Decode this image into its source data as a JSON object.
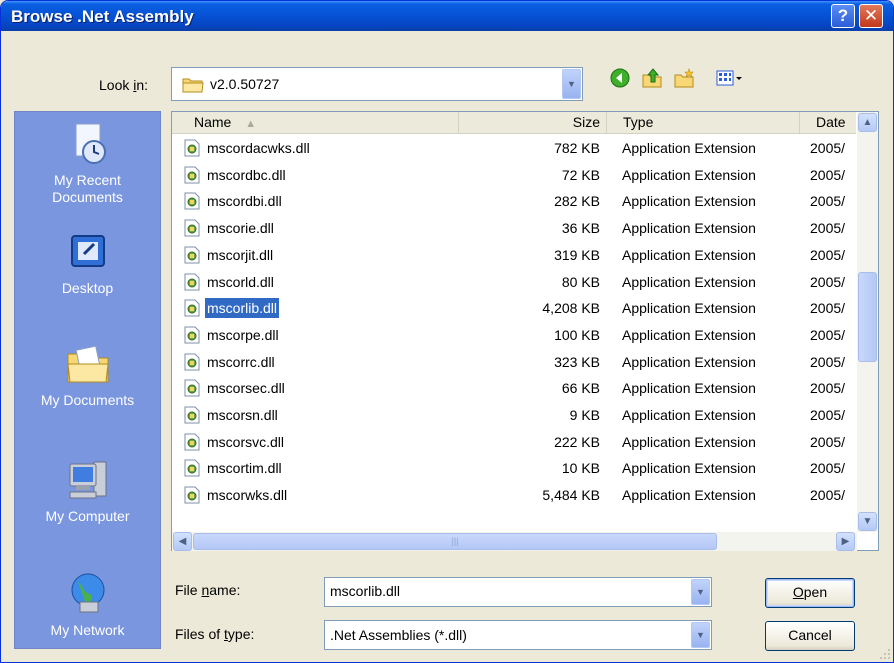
{
  "window": {
    "title": "Browse .Net Assembly"
  },
  "titlebar_buttons": {
    "help": "?",
    "close": "✕"
  },
  "look_in": {
    "label_pre": "Look ",
    "label_underlined": "i",
    "label_post": "n:",
    "value": "v2.0.50727"
  },
  "toolbar_icons": [
    "back-icon",
    "up-folder-icon",
    "new-folder-icon",
    "view-menu-icon"
  ],
  "places": [
    {
      "label_1": "My Recent",
      "label_2": "Documents",
      "icon": "recent-documents-icon"
    },
    {
      "label_1": "Desktop",
      "label_2": "",
      "icon": "desktop-icon"
    },
    {
      "label_1": "My Documents",
      "label_2": "",
      "icon": "my-documents-icon"
    },
    {
      "label_1": "My Computer",
      "label_2": "",
      "icon": "my-computer-icon"
    },
    {
      "label_1": "My Network",
      "label_2": "",
      "icon": "my-network-icon"
    }
  ],
  "columns": {
    "name": "Name",
    "size": "Size",
    "type": "Type",
    "date": "Date"
  },
  "files": [
    {
      "name": "mscordacwks.dll",
      "size": "782 KB",
      "type": "Application Extension",
      "date": "2005/"
    },
    {
      "name": "mscordbc.dll",
      "size": "72 KB",
      "type": "Application Extension",
      "date": "2005/"
    },
    {
      "name": "mscordbi.dll",
      "size": "282 KB",
      "type": "Application Extension",
      "date": "2005/"
    },
    {
      "name": "mscorie.dll",
      "size": "36 KB",
      "type": "Application Extension",
      "date": "2005/"
    },
    {
      "name": "mscorjit.dll",
      "size": "319 KB",
      "type": "Application Extension",
      "date": "2005/"
    },
    {
      "name": "mscorld.dll",
      "size": "80 KB",
      "type": "Application Extension",
      "date": "2005/"
    },
    {
      "name": "mscorlib.dll",
      "size": "4,208 KB",
      "type": "Application Extension",
      "date": "2005/"
    },
    {
      "name": "mscorpe.dll",
      "size": "100 KB",
      "type": "Application Extension",
      "date": "2005/"
    },
    {
      "name": "mscorrc.dll",
      "size": "323 KB",
      "type": "Application Extension",
      "date": "2005/"
    },
    {
      "name": "mscorsec.dll",
      "size": "66 KB",
      "type": "Application Extension",
      "date": "2005/"
    },
    {
      "name": "mscorsn.dll",
      "size": "9 KB",
      "type": "Application Extension",
      "date": "2005/"
    },
    {
      "name": "mscorsvc.dll",
      "size": "222 KB",
      "type": "Application Extension",
      "date": "2005/"
    },
    {
      "name": "mscortim.dll",
      "size": "10 KB",
      "type": "Application Extension",
      "date": "2005/"
    },
    {
      "name": "mscorwks.dll",
      "size": "5,484 KB",
      "type": "Application Extension",
      "date": "2005/"
    }
  ],
  "file_name": {
    "label_pre": "File ",
    "label_underlined": "n",
    "label_post": "ame:",
    "value": "mscorlib.dll"
  },
  "file_type": {
    "label_pre": "Files of ",
    "label_underlined": "t",
    "label_post": "ype:",
    "value": ".Net Assemblies (*.dll)"
  },
  "buttons": {
    "open_underlined": "O",
    "open_rest": "pen",
    "cancel": "Cancel"
  }
}
